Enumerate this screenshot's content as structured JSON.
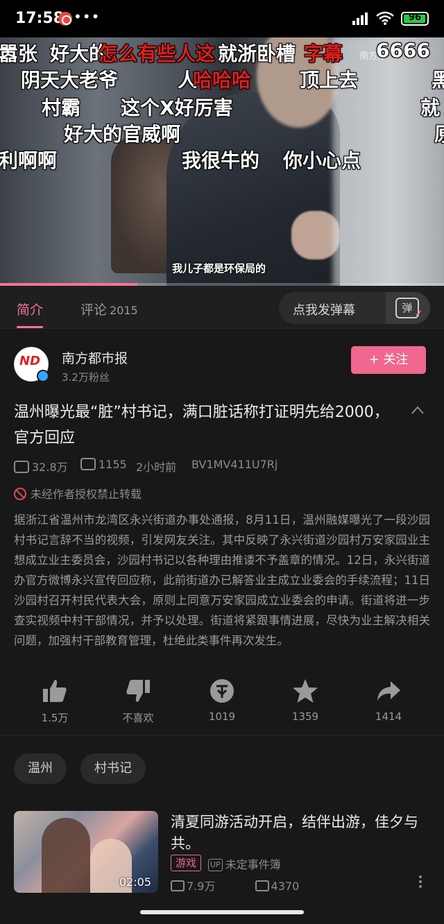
{
  "status_bar": {
    "time": "17:58",
    "dots": "•••",
    "battery": "96",
    "battery_level": 0.96
  },
  "video": {
    "watermark": "南方都",
    "subtitle": "我儿子都是环保局的",
    "progress": 0.31,
    "danmaku": [
      {
        "text": "嚣张",
        "color": "white"
      },
      {
        "text": "好大的",
        "color": "white"
      },
      {
        "text": "怎么有些人这",
        "color": "red"
      },
      {
        "text": "就浙卧槽",
        "color": "white"
      },
      {
        "text": "字幕",
        "color": "red"
      },
      {
        "text": "6666",
        "color": "white"
      },
      {
        "text": "阴天大老爷",
        "color": "white"
      },
      {
        "text": "人",
        "color": "white"
      },
      {
        "text": "哈哈哈",
        "color": "red"
      },
      {
        "text": "顶上去",
        "color": "white"
      },
      {
        "text": "黑",
        "color": "white"
      },
      {
        "text": "村霸",
        "color": "white"
      },
      {
        "text": "这个X好厉害",
        "color": "white"
      },
      {
        "text": "就",
        "color": "white"
      },
      {
        "text": "好大的官威啊",
        "color": "white"
      },
      {
        "text": "原",
        "color": "white"
      },
      {
        "text": "利啊啊",
        "color": "white"
      },
      {
        "text": "我很牛的",
        "color": "white"
      },
      {
        "text": "你小心点",
        "color": "white"
      }
    ]
  },
  "tabs": {
    "intro": "简介",
    "comments": "评论",
    "comments_count": "2015",
    "danmaku_placeholder": "点我发弹幕",
    "danmaku_button": "弹"
  },
  "author": {
    "logo": "ND",
    "name": "南方都市报",
    "fans": "3.2万粉丝",
    "follow_label": "+ 关注"
  },
  "video_info": {
    "title": "温州曝光最“脏”村书记，满口脏话称打证明先给2000，官方回应",
    "views": "32.8万",
    "danmaku_count": "1155",
    "time_ago": "2小时前",
    "bvid": "BV1MV411U7Rj",
    "notice": "未经作者授权禁止转载",
    "description": "据浙江省温州市龙湾区永兴街道办事处通报，8月11日，温州融媒曝光了一段沙园村书记言辞不当的视频，引发网友关注。其中反映了永兴街道沙园村万安家园业主想成立业主委员会，沙园村书记以各种理由推诿不予盖章的情况。12日，永兴街道办官方微博永兴宣传回应称，此前街道办已解答业主成立业委会的手续流程；11日沙园村召开村民代表大会，原则上同意万安家园成立业委会的申请。街道将进一步查实视频中村干部情况，并予以处理。街道将紧跟事情进展，尽快为业主解决相关问题，加强村干部教育管理，杜绝此类事件再次发生。"
  },
  "actions": {
    "like": "1.5万",
    "dislike": "不喜欢",
    "coin": "1019",
    "favorite": "1359",
    "share": "1414"
  },
  "tags": [
    "温州",
    "村书记"
  ],
  "recommendation": {
    "title": "清夏同游活动开启，结伴出游，佳夕与共。",
    "duration": "02:05",
    "category": "游戏",
    "up_badge": "UP",
    "uploader": "未定事件簿",
    "views": "7.9万",
    "danmaku_count": "4370"
  },
  "colors": {
    "accent": "#fb7299",
    "follow_bg": "#f0688f",
    "background": "#181818",
    "danmaku_red": "#e31c1c"
  }
}
